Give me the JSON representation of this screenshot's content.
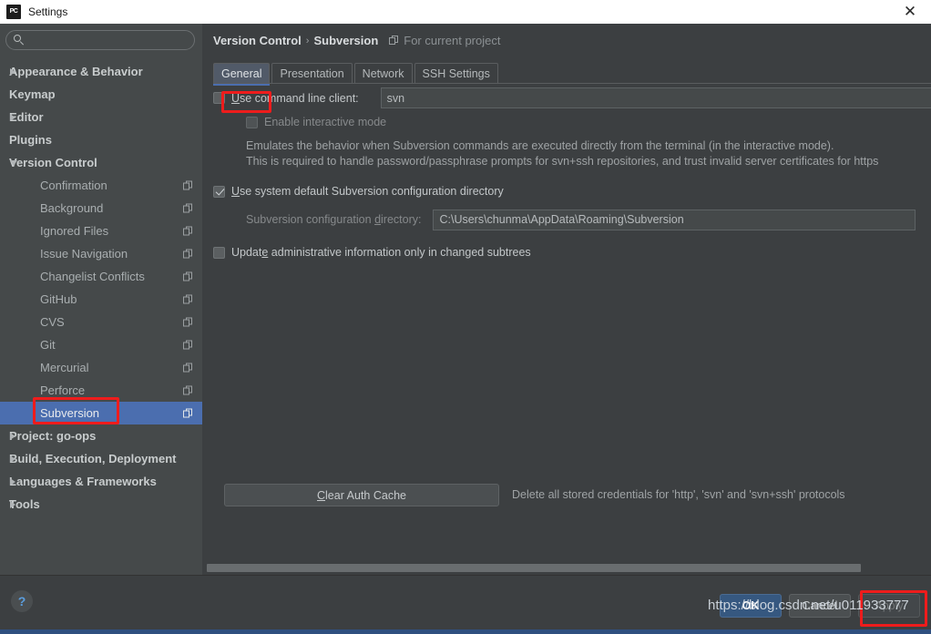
{
  "window": {
    "title": "Settings",
    "app_icon": "pycharm-icon",
    "close_label": "✕"
  },
  "sidebar": {
    "search": {
      "value": "",
      "placeholder": "",
      "icon": "search-icon"
    },
    "items": [
      {
        "label": "Appearance & Behavior",
        "level": "top",
        "arrow": "closed",
        "copy": false,
        "selected": false
      },
      {
        "label": "Keymap",
        "level": "top",
        "arrow": "none",
        "copy": false,
        "selected": false
      },
      {
        "label": "Editor",
        "level": "top",
        "arrow": "closed",
        "copy": false,
        "selected": false
      },
      {
        "label": "Plugins",
        "level": "top",
        "arrow": "none",
        "copy": false,
        "selected": false
      },
      {
        "label": "Version Control",
        "level": "top",
        "arrow": "open",
        "copy": false,
        "selected": false
      },
      {
        "label": "Confirmation",
        "level": "child",
        "arrow": "none",
        "copy": true,
        "selected": false
      },
      {
        "label": "Background",
        "level": "child",
        "arrow": "none",
        "copy": true,
        "selected": false
      },
      {
        "label": "Ignored Files",
        "level": "child",
        "arrow": "none",
        "copy": true,
        "selected": false
      },
      {
        "label": "Issue Navigation",
        "level": "child",
        "arrow": "none",
        "copy": true,
        "selected": false
      },
      {
        "label": "Changelist Conflicts",
        "level": "child",
        "arrow": "none",
        "copy": true,
        "selected": false
      },
      {
        "label": "GitHub",
        "level": "child",
        "arrow": "none",
        "copy": true,
        "selected": false
      },
      {
        "label": "CVS",
        "level": "child",
        "arrow": "none",
        "copy": true,
        "selected": false
      },
      {
        "label": "Git",
        "level": "child",
        "arrow": "none",
        "copy": true,
        "selected": false
      },
      {
        "label": "Mercurial",
        "level": "child",
        "arrow": "none",
        "copy": true,
        "selected": false
      },
      {
        "label": "Perforce",
        "level": "child",
        "arrow": "none",
        "copy": true,
        "selected": false
      },
      {
        "label": "Subversion",
        "level": "child",
        "arrow": "none",
        "copy": true,
        "selected": true
      },
      {
        "label": "Project: go-ops",
        "level": "top",
        "arrow": "closed",
        "copy": false,
        "selected": false
      },
      {
        "label": "Build, Execution, Deployment",
        "level": "top",
        "arrow": "closed",
        "copy": false,
        "selected": false
      },
      {
        "label": "Languages & Frameworks",
        "level": "top",
        "arrow": "closed",
        "copy": false,
        "selected": false
      },
      {
        "label": "Tools",
        "level": "top",
        "arrow": "closed",
        "copy": false,
        "selected": false
      }
    ]
  },
  "content": {
    "breadcrumb": {
      "parent": "Version Control",
      "separator": "›",
      "current": "Subversion",
      "scope": "For current project",
      "scope_icon": "copy-project-icon"
    },
    "tabs": [
      {
        "label": "General",
        "active": true
      },
      {
        "label": "Presentation",
        "active": false
      },
      {
        "label": "Network",
        "active": false
      },
      {
        "label": "SSH Settings",
        "active": false
      }
    ],
    "use_command_line": {
      "mnemonic": "U",
      "label_rest": "se command line client:",
      "checked": false,
      "value": "svn"
    },
    "enable_interactive": {
      "label": "Enable interactive mode",
      "checked": false,
      "disabled": true
    },
    "description_line1": "Emulates the behavior when Subversion commands are executed directly from the terminal (in the interactive mode).",
    "description_line2": "This is required to handle password/passphrase prompts for svn+ssh repositories, and trust invalid server certificates for https",
    "use_system_default": {
      "mnemonic": "U",
      "label_rest": "se system default Subversion configuration directory",
      "checked": true
    },
    "config_directory": {
      "label_pre": "Subversion configuration ",
      "mnemonic": "d",
      "label_post": "irectory:",
      "value": "C:\\Users\\chunma\\AppData\\Roaming\\Subversion"
    },
    "update_admin": {
      "label_pre": "Updat",
      "mnemonic": "e",
      "label_post": " administrative information only in changed subtrees",
      "checked": false
    },
    "clear_auth": {
      "mnemonic": "C",
      "label_rest": "lear Auth Cache",
      "hint": "Delete all stored credentials for 'http', 'svn' and 'svn+ssh' protocols"
    }
  },
  "footer": {
    "help_label": "?",
    "ok_label": "OK",
    "cancel_label": "Cancel",
    "apply_label": "Apply"
  },
  "watermark": {
    "text": "https://blog.csdn.net/u011933777"
  },
  "colors": {
    "selection": "#4b6eaf",
    "annotation": "#ee1c1c",
    "panel": "#3c3f41",
    "sidebar": "#45494a",
    "ok_button": "#365880"
  }
}
